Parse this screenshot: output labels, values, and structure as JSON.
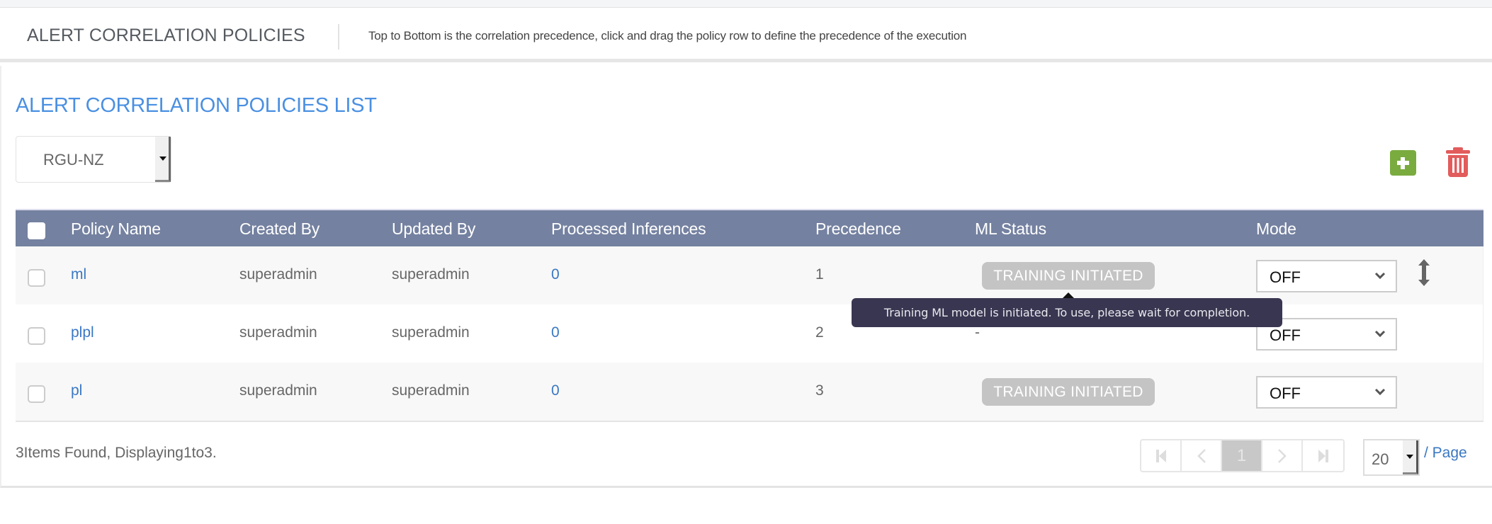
{
  "header": {
    "title": "ALERT CORRELATION POLICIES",
    "subtitle": "Top to Bottom is the correlation precedence, click and drag the policy row to define the precedence of the execution"
  },
  "list": {
    "title": "ALERT CORRELATION POLICIES  LIST",
    "scope_select": {
      "value": "RGU-NZ"
    },
    "actions": {
      "add_icon": "plus-square-icon",
      "delete_icon": "trash-icon"
    },
    "colors": {
      "header_bg": "#7481a0",
      "add": "#7aab3f",
      "delete": "#e25c5c",
      "link": "#3a78c2",
      "accent": "#4a90e2"
    }
  },
  "table": {
    "columns": [
      "Policy Name",
      "Created By",
      "Updated By",
      "Processed Inferences",
      "Precedence",
      "ML Status",
      "Mode"
    ],
    "rows": [
      {
        "name": "ml",
        "created_by": "superadmin",
        "updated_by": "superadmin",
        "processed": "0",
        "precedence": "1",
        "ml_status": "TRAINING INITIATED",
        "mode": "OFF"
      },
      {
        "name": "plpl",
        "created_by": "superadmin",
        "updated_by": "superadmin",
        "processed": "0",
        "precedence": "2",
        "ml_status": "-",
        "mode": "OFF"
      },
      {
        "name": "pl",
        "created_by": "superadmin",
        "updated_by": "superadmin",
        "processed": "0",
        "precedence": "3",
        "ml_status": "TRAINING INITIATED",
        "mode": "OFF"
      }
    ]
  },
  "tooltip": {
    "text": "Training ML model is initiated. To use, please wait for completion."
  },
  "footer": {
    "summary": "3Items Found, Displaying1to3.",
    "pagination": {
      "first": "⏮",
      "prev": "‹",
      "current": "1",
      "next": "›",
      "last": "⏭"
    },
    "page_size": "20",
    "per_page_label": "/ Page"
  }
}
